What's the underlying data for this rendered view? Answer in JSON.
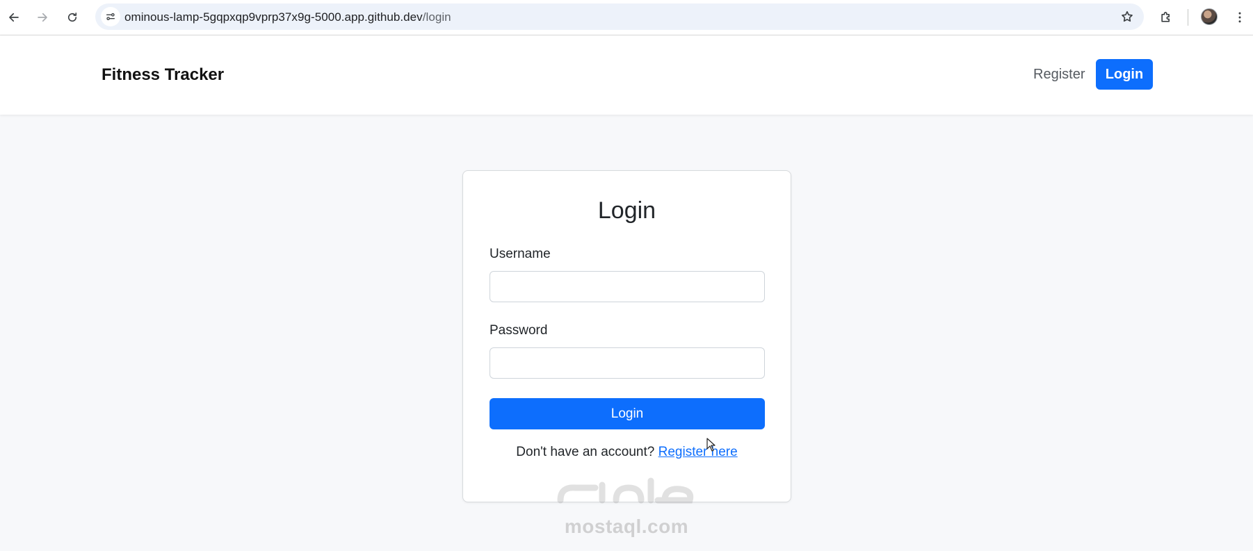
{
  "browser": {
    "url_host": "ominous-lamp-5gqpxqp9vprp37x9g-5000.app.github.dev",
    "url_path": "/login",
    "icons": {
      "back": "arrow-left-icon",
      "forward": "arrow-right-icon",
      "reload": "reload-icon",
      "site_info": "tune-icon",
      "bookmark": "star-icon",
      "extensions": "puzzle-icon",
      "menu": "kebab-menu-icon"
    }
  },
  "header": {
    "brand": "Fitness Tracker",
    "nav": {
      "register": "Register",
      "login": "Login"
    }
  },
  "login_form": {
    "title": "Login",
    "username_label": "Username",
    "username_value": "",
    "password_label": "Password",
    "password_value": "",
    "submit_label": "Login",
    "register_prompt": "Don't have an account?",
    "register_link": "Register here"
  },
  "watermark": {
    "text": "mostaql.com"
  },
  "colors": {
    "primary": "#0d6efd",
    "page_background": "#f7f8fa",
    "card_border": "#d7dadd"
  }
}
